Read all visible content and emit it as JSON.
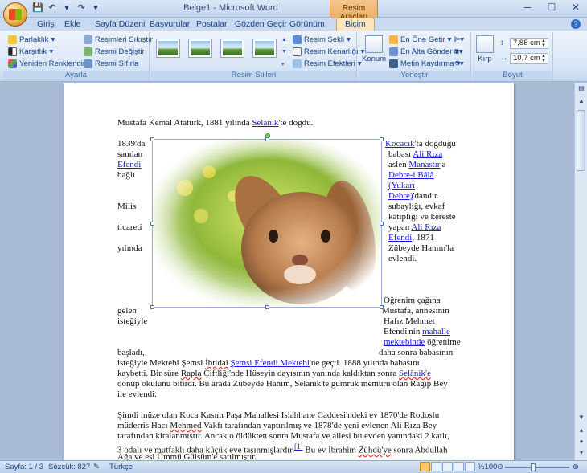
{
  "window": {
    "title": "Belge1 - Microsoft Word",
    "context_tab_group": "Resim Araçları"
  },
  "tabs": [
    "Giriş",
    "Ekle",
    "Sayfa Düzeni",
    "Başvurular",
    "Postalar",
    "Gözden Geçir",
    "Görünüm",
    "Biçim"
  ],
  "active_tab": "Biçim",
  "ribbon": {
    "ayarla": {
      "label": "Ayarla",
      "parlaklik": "Parlaklık",
      "karsitlik": "Karşıtlık",
      "yeniden_renklendir": "Yeniden Renklendir",
      "resimleri_sikistir": "Resimleri Sıkıştır",
      "resmi_degistir": "Resmi Değiştir",
      "resmi_sifirla": "Resmi Sıfırla"
    },
    "resim_stilleri": {
      "label": "Resim Stilleri",
      "resim_sekli": "Resim Şekli",
      "resim_kenarligi": "Resim Kenarlığı",
      "resim_efektleri": "Resim Efektleri"
    },
    "yerlestir": {
      "label": "Yerleştir",
      "konum": "Konum",
      "en_one_getir": "En Öne Getir",
      "en_alta_gonder": "En Alta Gönder",
      "metin_kaydirma": "Metin Kaydırma"
    },
    "boyut": {
      "label": "Boyut",
      "kirp": "Kırp",
      "height": "7,88 cm",
      "width": "10,7 cm"
    }
  },
  "document": {
    "line1_a": "Mustafa Kemal Atatürk, 1881 yılında ",
    "line1_link": "Selanik",
    "line1_b": "'te doğdu.",
    "left_col": {
      "l1": "1839'da",
      "l2": "sanılan",
      "l3": "Efendi",
      "l4": "bağlı",
      "l5": "Milis",
      "l6": "ticareti",
      "l7": "yılında",
      "l8": "gelen",
      "l9": "isteğiyle",
      "l10": "başladı,"
    },
    "right_col": {
      "r1_link": "Kocacık",
      "r1_text": "'ta doğduğu",
      "r2_text": "babası ",
      "r2_link": "Ali Rıza",
      "r3_text": "aslen ",
      "r3_link": "Manastır",
      "r3_end": "'a",
      "r4_link": "Debre-i Bâlâ",
      "r5_link": "(Yukarı",
      "r6_link": "Debre)",
      "r6_text": "'dandır.",
      "r7": "subaylığı, evkaf",
      "r8": "kâtipliği ve kereste",
      "r9_text": "yapan ",
      "r9_link": "Ali Rıza",
      "r10_link": "Efendi",
      "r10_text": ", 1871",
      "r11": "Zübeyde Hanım'la",
      "r12": "evlendi.",
      "r13": "Öğrenim çağına",
      "r14": "Mustafa, annesinin",
      "r15": "Hafız Mehmet",
      "r16_text": "Efendi'nin ",
      "r16_link": "mahalle",
      "r17_link": "mektebinde",
      "r17_text": " öğrenime",
      "r18": "daha sonra babasının"
    },
    "para_full": {
      "p1_a": "isteğiyle Mektebi Şemsi ",
      "p1_sq": "İbtidai",
      "p1_sp": " ",
      "p1_link": "Şemsi Efendi Mektebi",
      "p1_b": "'ne geçti. 1888 yılında babasını",
      "p2_a": "kaybetti. Bir süre ",
      "p2_sq": "Rapla",
      "p2_b": " Çiftliği'nde Hüseyin dayısının yanında kaldıktan sonra ",
      "p2_link": "Selânik'e",
      "p3": "dönüp okulunu bitirdi.  Bu arada Zübeyde Hanım, Selanik'te gümrük memuru olan Ragıp Bey",
      "p4": "ile evlendi.",
      "p5": "Şimdi müze olan Koca Kasım Paşa Mahallesi  Islahhane Caddesi'ndeki ev 1870'de Rodoslu",
      "p6_a": "müderris Hacı ",
      "p6_sq": "Mehmed",
      "p6_b": " Vakfı tarafından yaptırılmış  ve 1878'de yeni evlenen Ali Rıza Bey",
      "p7": "tarafından kiralanmıştır.  Ancak o öldükten sonra  Mustafa ve ailesi  bu evden yanındaki 2 katlı,",
      "p8_a": "3 odalı ve mutfaklı daha küçük eve taşınmışlardır.",
      "p8_fn": "[1]",
      "p8_b": " Bu ev İbrahim ",
      "p8_sq": "Zühdü'ye",
      "p8_c": " sonra Abdullah",
      "p9": "Ağa ve esi  Ümmü Gülsüm'e satılmıştır."
    }
  },
  "statusbar": {
    "page": "Sayfa: 1 / 3",
    "words": "Sözcük: 827",
    "language": "Türkçe",
    "zoom": "%100"
  }
}
